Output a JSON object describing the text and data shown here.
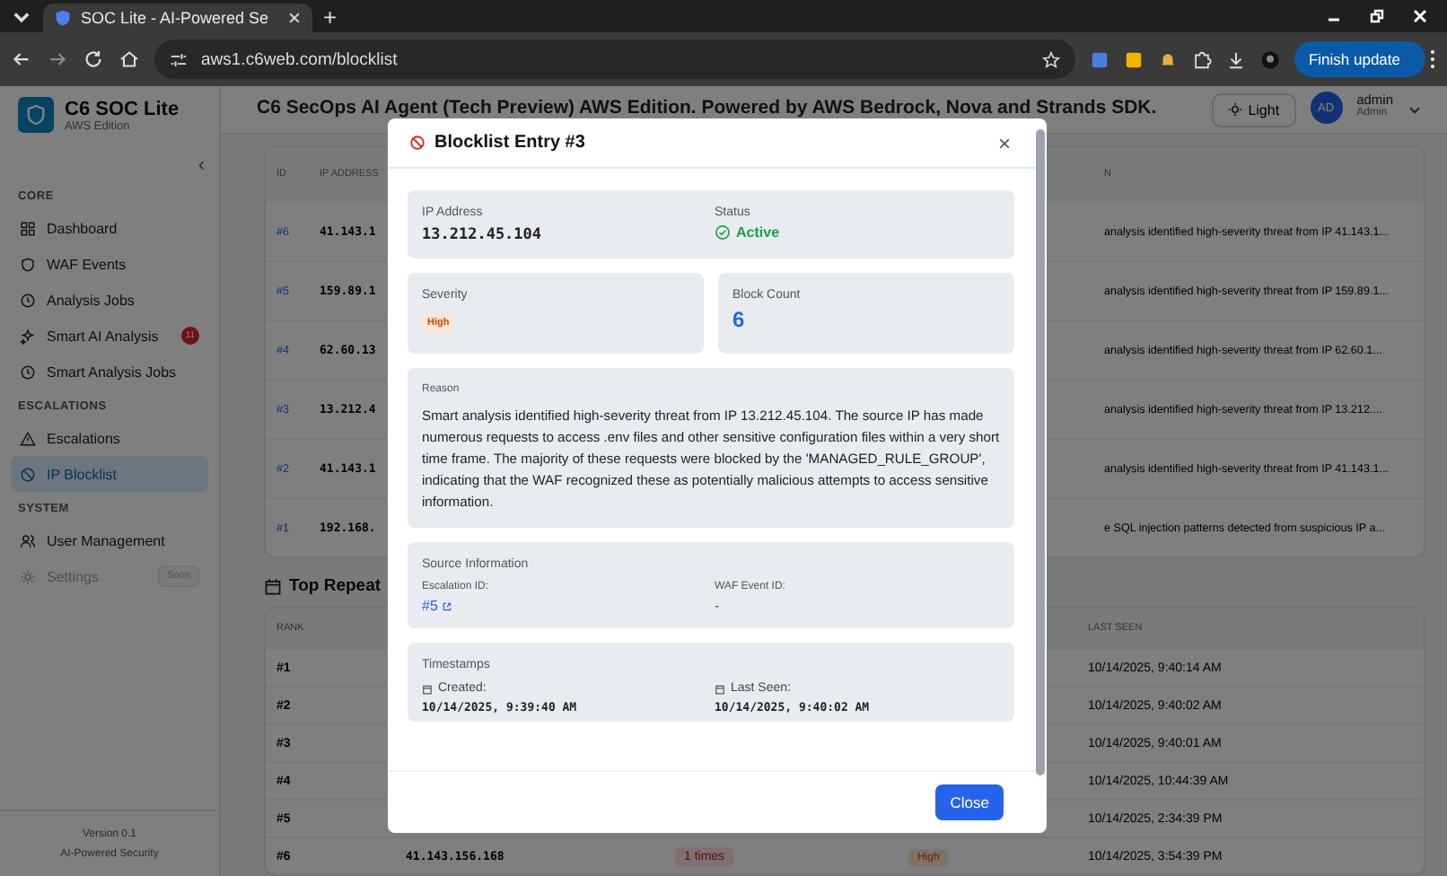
{
  "browser": {
    "tab_title": "SOC Lite - AI-Powered Se",
    "new_tab": "+",
    "url": "aws1.c6web.com/blocklist",
    "update_button": "Finish update"
  },
  "sidebar": {
    "brand": "C6 SOC Lite",
    "edition": "AWS Edition",
    "collapse": "‹",
    "sections": [
      {
        "label": "CORE",
        "items": [
          {
            "label": "Dashboard",
            "selected": false,
            "disabled": false
          },
          {
            "label": "WAF Events",
            "selected": false,
            "disabled": false
          },
          {
            "label": "Analysis Jobs",
            "selected": false,
            "disabled": false
          },
          {
            "label": "Smart AI Analysis",
            "selected": false,
            "disabled": false,
            "badge": "11"
          },
          {
            "label": "Smart Analysis Jobs",
            "selected": false,
            "disabled": false
          }
        ]
      },
      {
        "label": "ESCALATIONS",
        "items": [
          {
            "label": "Escalations",
            "selected": false,
            "disabled": false
          },
          {
            "label": "IP Blocklist",
            "selected": true,
            "disabled": false
          }
        ]
      },
      {
        "label": "SYSTEM",
        "items": [
          {
            "label": "User Management",
            "selected": false,
            "disabled": false
          },
          {
            "label": "Settings",
            "selected": false,
            "disabled": true,
            "badge": "Soon"
          }
        ]
      }
    ],
    "version": "Version 0.1",
    "tagline": "AI-Powered Security"
  },
  "header": {
    "title": "C6 SecOps AI Agent (Tech Preview) AWS Edition. Powered by AWS Bedrock, Nova and Strands SDK.",
    "theme_button": "Light",
    "avatar": "AD",
    "user": "admin",
    "role": "Admin"
  },
  "blocklist_table": {
    "columns": [
      "ID",
      "IP ADDRESS",
      "N"
    ],
    "rows": [
      {
        "id": "#6",
        "ip": "41.143.1",
        "reason": "analysis identified high-severity threat from IP 41.143.1..."
      },
      {
        "id": "#5",
        "ip": "159.89.1",
        "reason": "analysis identified high-severity threat from IP 159.89.1..."
      },
      {
        "id": "#4",
        "ip": "62.60.13",
        "reason": "analysis identified high-severity threat from IP 62.60.1..."
      },
      {
        "id": "#3",
        "ip": "13.212.4",
        "reason": "analysis identified high-severity threat from IP 13.212...."
      },
      {
        "id": "#2",
        "ip": "41.143.1",
        "reason": "analysis identified high-severity threat from IP 41.143.1..."
      },
      {
        "id": "#1",
        "ip": "192.168.",
        "reason": "e SQL injection patterns detected from suspicious IP a..."
      }
    ]
  },
  "repeat_table": {
    "title": "Top Repeat",
    "columns": [
      "RANK",
      "LAST SEEN"
    ],
    "rows": [
      {
        "rank": "#1",
        "last_seen": "10/14/2025, 9:40:14 AM"
      },
      {
        "rank": "#2",
        "last_seen": "10/14/2025, 9:40:02 AM"
      },
      {
        "rank": "#3",
        "last_seen": "10/14/2025, 9:40:01 AM"
      },
      {
        "rank": "#4",
        "last_seen": "10/14/2025, 10:44:39 AM"
      },
      {
        "rank": "#5",
        "last_seen": "10/14/2025, 2:34:39 PM"
      },
      {
        "rank": "#6",
        "ip": "41.143.156.168",
        "count": "1 times",
        "severity": "High",
        "last_seen": "10/14/2025, 3:54:39 PM"
      }
    ]
  },
  "modal": {
    "title": "Blocklist Entry #3",
    "close": "×",
    "ip_label": "IP Address",
    "ip": "13.212.45.104",
    "status_label": "Status",
    "status": "Active",
    "severity_label": "Severity",
    "severity": "High",
    "count_label": "Block Count",
    "count": "6",
    "reason_label": "Reason",
    "reason": "Smart analysis identified high-severity threat from IP 13.212.45.104. The source IP has made numerous requests to access .env files and other sensitive configuration files within a very short time frame. The majority of these requests were blocked by the 'MANAGED_RULE_GROUP', indicating that the WAF recognized these as potentially malicious attempts to access sensitive information.",
    "source_label": "Source Information",
    "escalation_label": "Escalation ID:",
    "escalation": "#5",
    "waf_label": "WAF Event ID:",
    "waf": "-",
    "timestamps_label": "Timestamps",
    "created_label": "Created:",
    "created": "10/14/2025, 9:39:40 AM",
    "last_seen_label": "Last Seen:",
    "last_seen": "10/14/2025, 9:40:02 AM",
    "close_button": "Close"
  }
}
